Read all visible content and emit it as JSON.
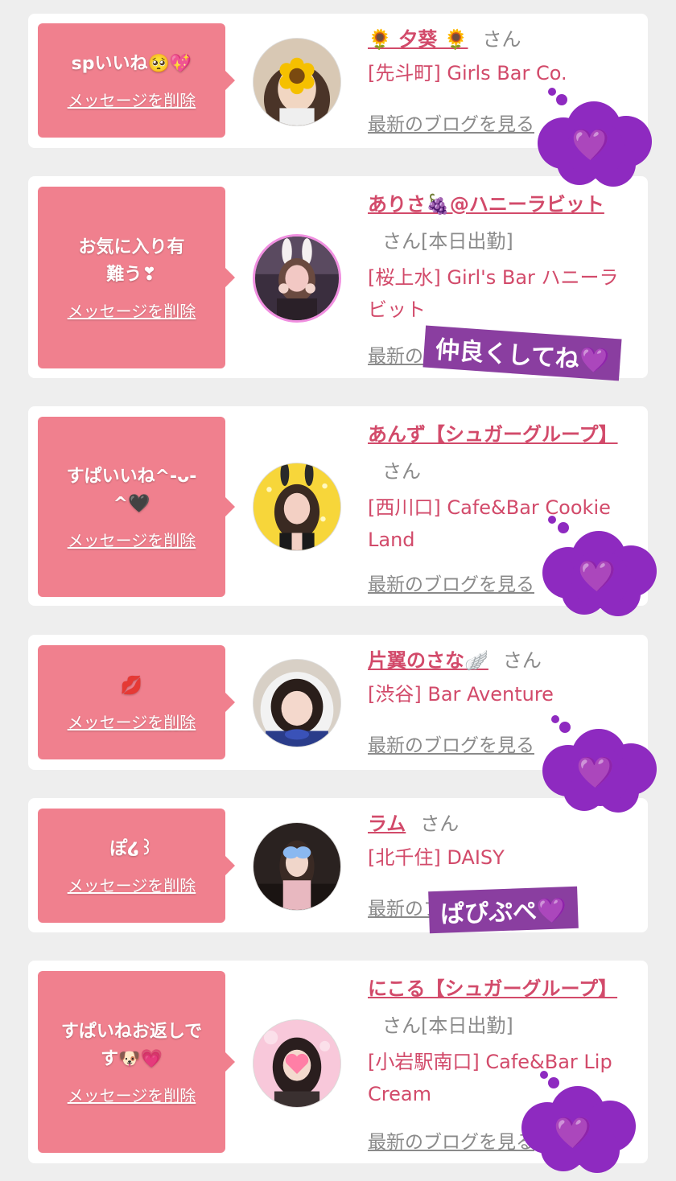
{
  "entries": [
    {
      "message": "spいいね🥺💖",
      "delete_label": "メッセージを削除",
      "name": "🌻 夕葵 🌻",
      "honorific": "さん",
      "status": "",
      "shop": "[先斗町] Girls Bar Co.",
      "blog_label": "最新のブログを見る",
      "avatar_icon": "sunflower-face-avatar"
    },
    {
      "message": "お気に入り有難う❣",
      "delete_label": "メッセージを削除",
      "name": "ありさ🍇@ハニーラビット",
      "honorific": "さん",
      "status": "[本日出勤]",
      "shop": "[桜上水] Girl's Bar ハニーラビット",
      "blog_label": "最新のブログを見る",
      "avatar_icon": "bunny-ears-avatar"
    },
    {
      "message": "すぱいいね^-ᴗ-^🖤",
      "delete_label": "メッセージを削除",
      "name": "あんず【シュガーグループ】",
      "honorific": "さん",
      "status": "",
      "shop": "[西川口] Cafe&Bar Cookie Land",
      "blog_label": "最新のブログを見る",
      "avatar_icon": "bunny-ears-avatar"
    },
    {
      "message": "💋",
      "delete_label": "メッセージを削除",
      "name": "片翼のさな🪽",
      "honorific": "さん",
      "status": "",
      "shop": "[渋谷] Bar Aventure",
      "blog_label": "最新のブログを見る",
      "avatar_icon": "girl-avatar"
    },
    {
      "message": "ぽ໒꒱",
      "delete_label": "メッセージを削除",
      "name": "ラム",
      "honorific": "さん",
      "status": "",
      "shop": "[北千住] DAISY",
      "blog_label": "最新のブログを見る",
      "avatar_icon": "butterfly-face-avatar"
    },
    {
      "message": "すぱいねお返しです🐶💗",
      "delete_label": "メッセージを削除",
      "name": "にこる【シュガーグループ】",
      "honorific": "さん",
      "status": "[本日出勤]",
      "shop": "[小岩駅南口] Cafe&Bar Lip Cream",
      "blog_label": "最新のブログを見る",
      "avatar_icon": "heart-face-avatar"
    }
  ],
  "stickers": {
    "heart": "💜",
    "label_1": "仲良くしてね💜",
    "label_2": "ぱぴぷぺ💜"
  },
  "colors": {
    "message_bg": "#f0808e",
    "name": "#d24a6a",
    "cloud": "#8e2ac0",
    "label_bg": "#8a3ea0"
  }
}
